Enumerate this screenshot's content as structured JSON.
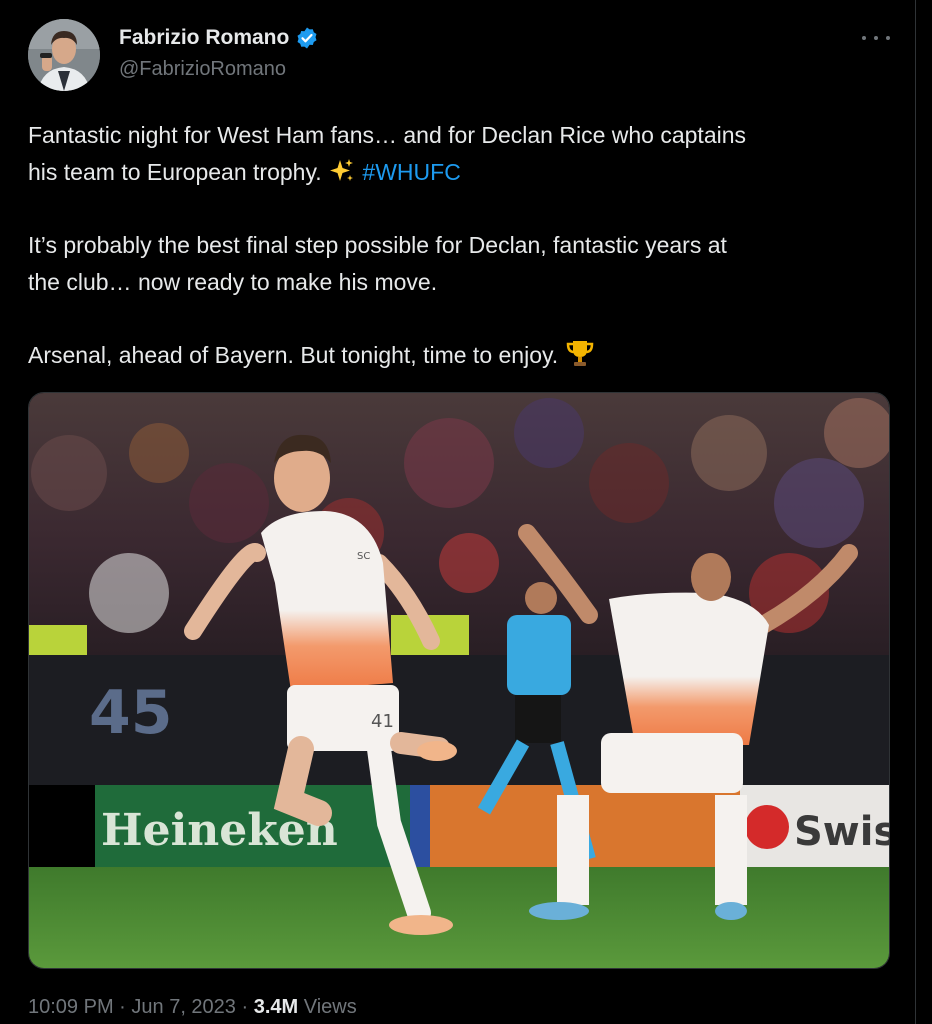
{
  "author": {
    "display_name": "Fabrizio Romano",
    "handle": "@FabrizioRomano",
    "verified": true
  },
  "tweet": {
    "line1_a": "Fantastic night for West Ham fans… and for Declan Rice who captains",
    "line1_b": "his team to European trophy.",
    "emoji1": "sparkles-emoji",
    "hashtag": "#WHUFC",
    "line2_a": "It’s probably the best final step possible for Declan, fantastic years at",
    "line2_b": "the club… now ready to make his move.",
    "line3": "Arsenal, ahead of Bayern. But tonight, time to enjoy.",
    "emoji2": "trophy-emoji"
  },
  "photo": {
    "board_left": "Heineken",
    "board_right": "Swiss",
    "board_number": "45",
    "sleeve": "SC",
    "shorts_number": "41"
  },
  "meta": {
    "time": "10:09 PM",
    "sep1": " · ",
    "date": "Jun 7, 2023",
    "sep2": " · ",
    "views": "3.4M",
    "views_label": " Views"
  },
  "colors": {
    "accent": "#1d9bf0",
    "background": "#000000",
    "muted": "#71767b"
  }
}
